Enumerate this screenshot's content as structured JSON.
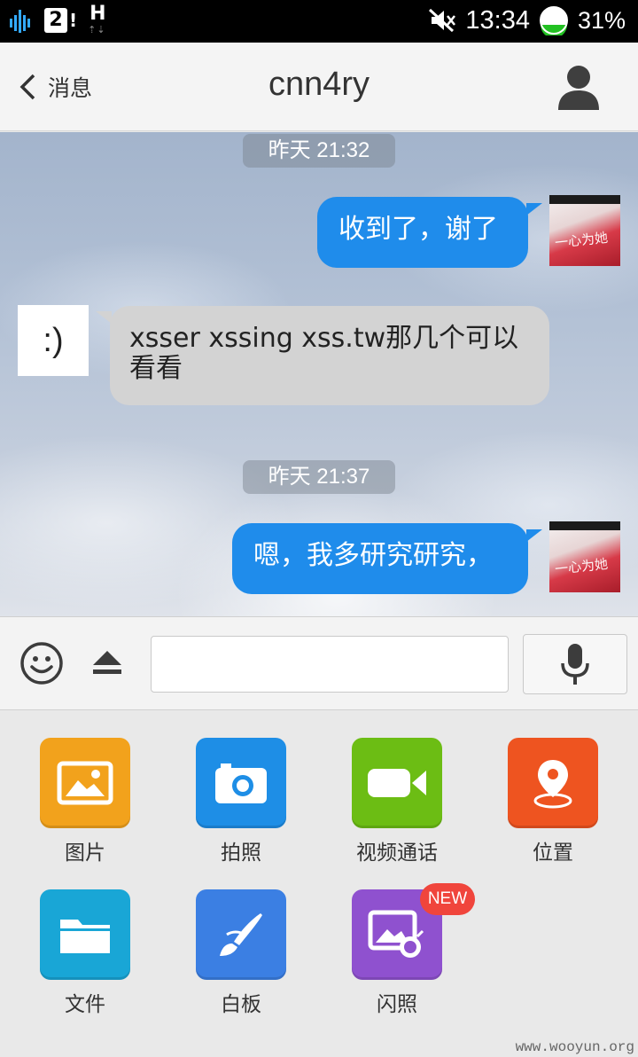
{
  "status_bar": {
    "sim_slot": "2",
    "sim_alert": "!",
    "network_type": "H",
    "network_arrows": "⇡⇣",
    "time": "13:34",
    "battery_percent": "31%",
    "battery_level": 0.31
  },
  "header": {
    "back_label": "消息",
    "title": "cnn4ry"
  },
  "chat": {
    "messages": [
      {
        "type": "time",
        "text": "昨天 21:32"
      },
      {
        "type": "out",
        "text": "收到了，谢了"
      },
      {
        "type": "in",
        "avatar_text": ":)",
        "text": "xsser xssing xss.tw那几个可以看看"
      },
      {
        "type": "time",
        "text": "昨天 21:37"
      },
      {
        "type": "out",
        "text": "嗯，我多研究研究，"
      }
    ],
    "self_avatar_text": "一心为她"
  },
  "input_bar": {
    "placeholder": ""
  },
  "panel": {
    "items": [
      {
        "label": "图片",
        "color": "#f2a21c",
        "icon": "image-icon"
      },
      {
        "label": "拍照",
        "color": "#1e8ee6",
        "icon": "camera-icon"
      },
      {
        "label": "视频通话",
        "color": "#6cbd14",
        "icon": "video-call-icon"
      },
      {
        "label": "位置",
        "color": "#ee5420",
        "icon": "location-icon"
      },
      {
        "label": "文件",
        "color": "#19a6d6",
        "icon": "folder-icon"
      },
      {
        "label": "白板",
        "color": "#3b7fe3",
        "icon": "whiteboard-brush-icon"
      },
      {
        "label": "闪照",
        "color": "#8f51cf",
        "icon": "flash-photo-icon",
        "badge": "NEW"
      }
    ]
  },
  "watermark": "www.wooyun.org"
}
